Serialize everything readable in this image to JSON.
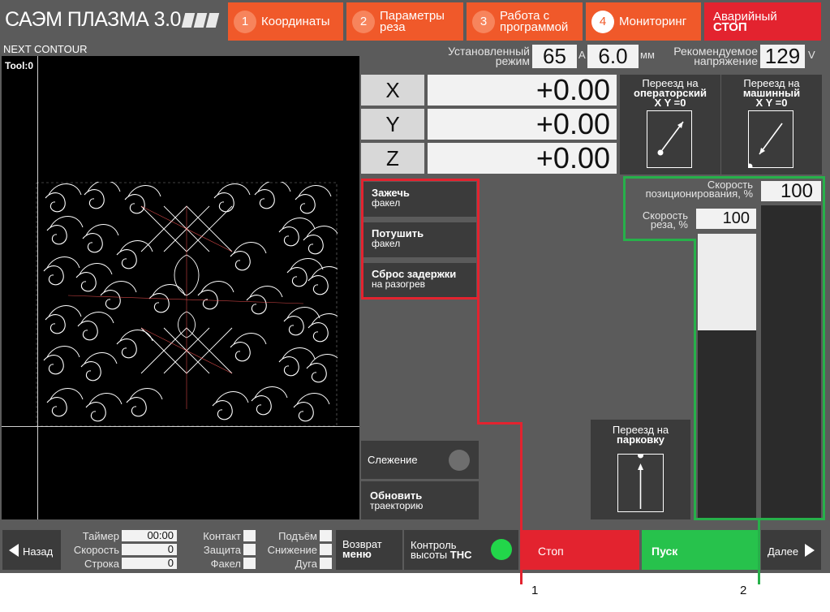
{
  "header": {
    "app_title": "САЭМ ПЛАЗМА 3.0",
    "tabs": [
      {
        "num": "1",
        "label": "Координаты"
      },
      {
        "num": "2",
        "label_line1": "Параметры",
        "label_line2": "реза"
      },
      {
        "num": "3",
        "label_line1": "Работа с",
        "label_line2": "программой"
      },
      {
        "num": "4",
        "label": "Мониторинг"
      }
    ],
    "emergency_line1": "Аварийный",
    "emergency_line2": "СТОП"
  },
  "status": {
    "next_contour": "NEXT CONTOUR",
    "mode_label_line1": "Установленный",
    "mode_label_line2": "режим",
    "mode_current": "65",
    "unit_a": "А",
    "mode_thickness": "6.0",
    "unit_mm": "мм",
    "voltage_label_line1": "Рекомендуемое",
    "voltage_label_line2": "напряжение",
    "voltage_value": "129",
    "unit_v": "V"
  },
  "canvas": {
    "tool_label": "Tool:0"
  },
  "coords": {
    "x_label": "X",
    "x_value": "+0.00",
    "y_label": "Y",
    "y_value": "+0.00",
    "z_label": "Z",
    "z_value": "+0.00"
  },
  "move_buttons": {
    "operator_line1": "Переезд на",
    "operator_line2": "операторский",
    "operator_line3": "X Y =0",
    "machine_line1": "Переезд на",
    "machine_line2": "машинный",
    "machine_line3": "X Y =0",
    "park_line1": "Переезд на",
    "park_line2": "парковку"
  },
  "torch_buttons": {
    "ignite_title": "Зажечь",
    "ignite_sub": "факел",
    "extinguish_title": "Потушить",
    "extinguish_sub": "факел",
    "reset_title": "Сброс задержки",
    "reset_sub": "на разогрев"
  },
  "speeds": {
    "positioning_label_line1": "Скорость",
    "positioning_label_line2": "позиционирования, %",
    "positioning_value": "100",
    "cutting_label_line1": "Скорость",
    "cutting_label_line2": "реза, %",
    "cutting_value": "100",
    "cutting_fill_fraction": 0.66
  },
  "side_buttons": {
    "tracking_label": "Слежение",
    "refresh_title": "Обновить",
    "refresh_sub": "траекторию"
  },
  "bottom": {
    "back_label": "Назад",
    "timer_label": "Таймер",
    "timer_value": "00:00",
    "speed_label": "Скорость",
    "speed_value": "0",
    "line_label": "Строка",
    "line_value": "0",
    "contact_label": "Контакт",
    "protection_label": "Защита",
    "torch_label": "Факел",
    "lift_label": "Подъём",
    "lower_label": "Снижение",
    "arc_label": "Дуга",
    "return_line1": "Возврат",
    "return_line2": "меню",
    "thc_line1": "Контроль",
    "thc_line2_a": "высоты",
    "thc_line2_b": "THC",
    "stop_label": "Стоп",
    "start_label": "Пуск",
    "next_label": "Далее"
  },
  "callouts": {
    "one": "1",
    "two": "2"
  },
  "colors": {
    "tab_orange": "#f0592a",
    "emergency_red": "#e3232f",
    "stop_red": "#e3232f",
    "start_green": "#27c24c",
    "thc_indicator": "#22d64a",
    "highlight_red": "#e3232f",
    "highlight_green": "#27b04a"
  }
}
